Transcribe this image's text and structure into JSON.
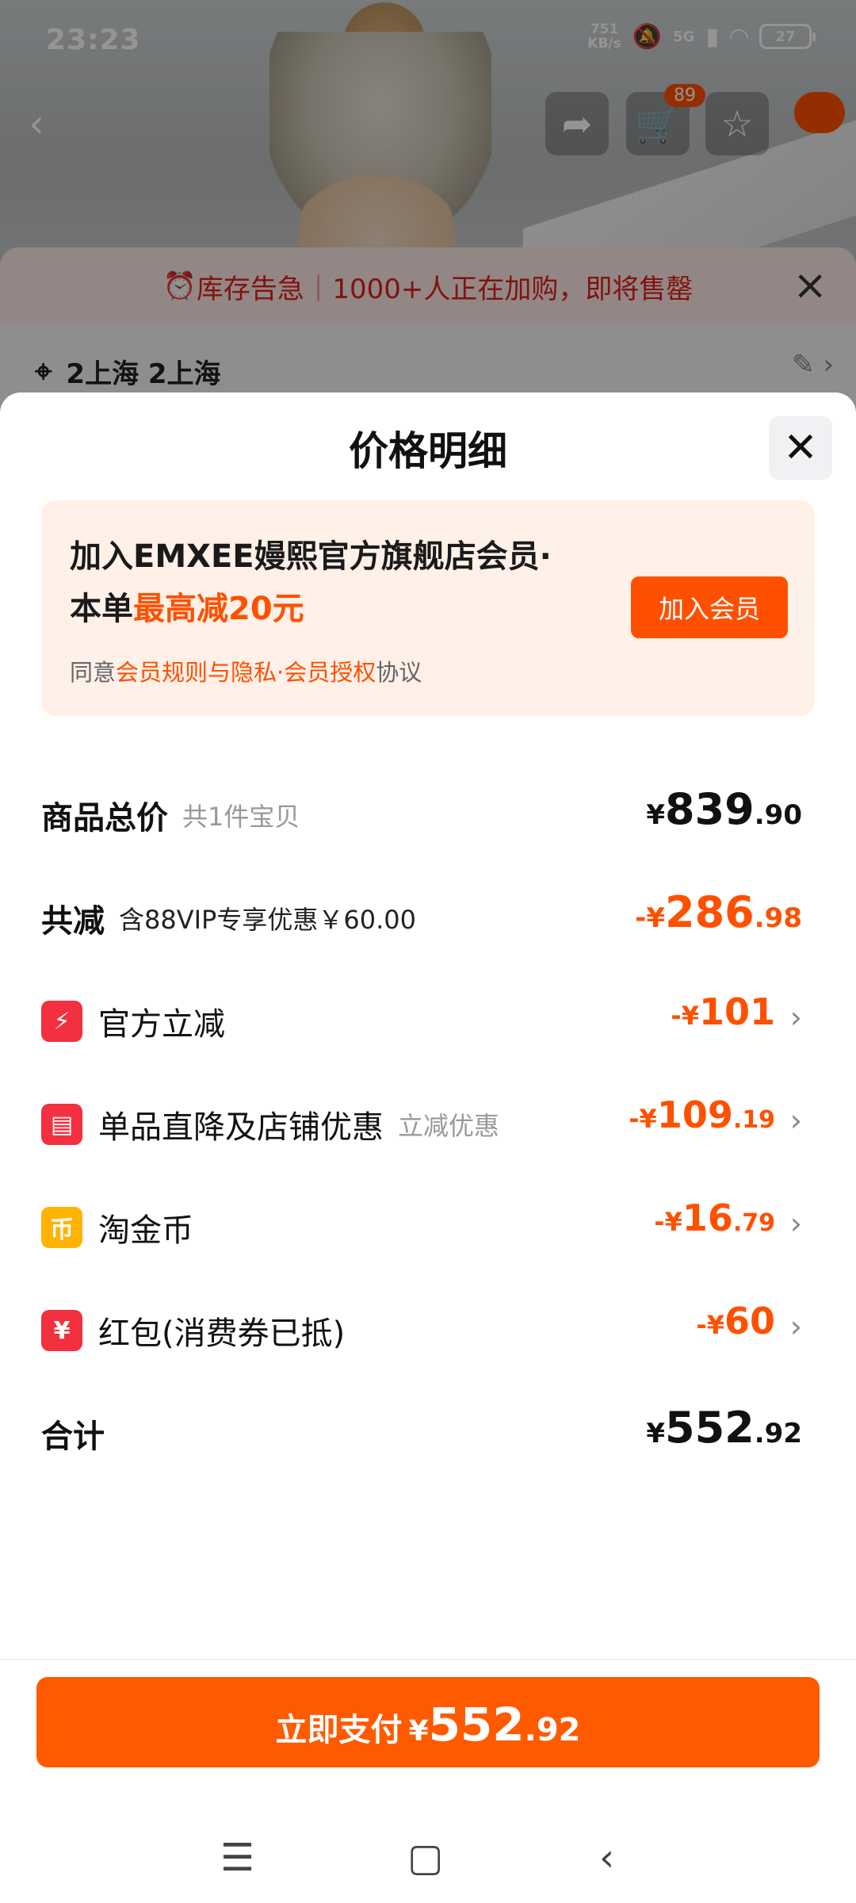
{
  "status_bar": {
    "time": "23:23",
    "net_speed_top": "751",
    "net_speed_bottom": "KB/s",
    "network": "5G",
    "battery": "27"
  },
  "nav": {
    "cart_badge": "89",
    "icons": [
      "back-icon",
      "share-icon",
      "cart-icon",
      "star-icon",
      "message-icon"
    ]
  },
  "stock_alert": {
    "label": "库存告急",
    "message": "1000+人正在加购，即将售罄"
  },
  "address": {
    "text": "2上海 2上海"
  },
  "modal": {
    "title": "价格明细",
    "member": {
      "line1": "加入EMXEE嫚熙官方旗舰店会员·",
      "line2_prefix": "本单",
      "line2_highlight": "最高减20元",
      "agree_prefix": "同意",
      "agree_link": "会员规则与隐私·会员授权",
      "agree_suffix": "协议",
      "button": "加入会员"
    },
    "total": {
      "label": "商品总价",
      "sub": "共1件宝贝",
      "yen": "¥",
      "int": "839",
      "dec": ".90"
    },
    "reduce": {
      "label": "共减",
      "sub": "含88VIP专享优惠￥60.00",
      "yen": "-¥",
      "int": "286",
      "dec": ".98"
    },
    "details": [
      {
        "label": "官方立减",
        "sub": "",
        "yen": "-¥",
        "int": "101",
        "dec": "",
        "icon": "lightning-icon"
      },
      {
        "label": "单品直降及店铺优惠",
        "sub": "立减优惠",
        "yen": "-¥",
        "int": "109",
        "dec": ".19",
        "icon": "shop-icon"
      },
      {
        "label": "淘金币",
        "sub": "",
        "yen": "-¥",
        "int": "16",
        "dec": ".79",
        "icon": "coin-icon"
      },
      {
        "label": "红包(消费券已抵)",
        "sub": "",
        "yen": "-¥",
        "int": "60",
        "dec": "",
        "icon": "red-packet-icon"
      }
    ],
    "sum": {
      "label": "合计",
      "yen": "¥",
      "int": "552",
      "dec": ".92"
    },
    "pay": {
      "label": "立即支付",
      "yen": "¥",
      "int": "552",
      "dec": ".92"
    }
  },
  "colors": {
    "accent": "#ff5000",
    "danger": "#f23040",
    "gold": "#ffb300"
  }
}
